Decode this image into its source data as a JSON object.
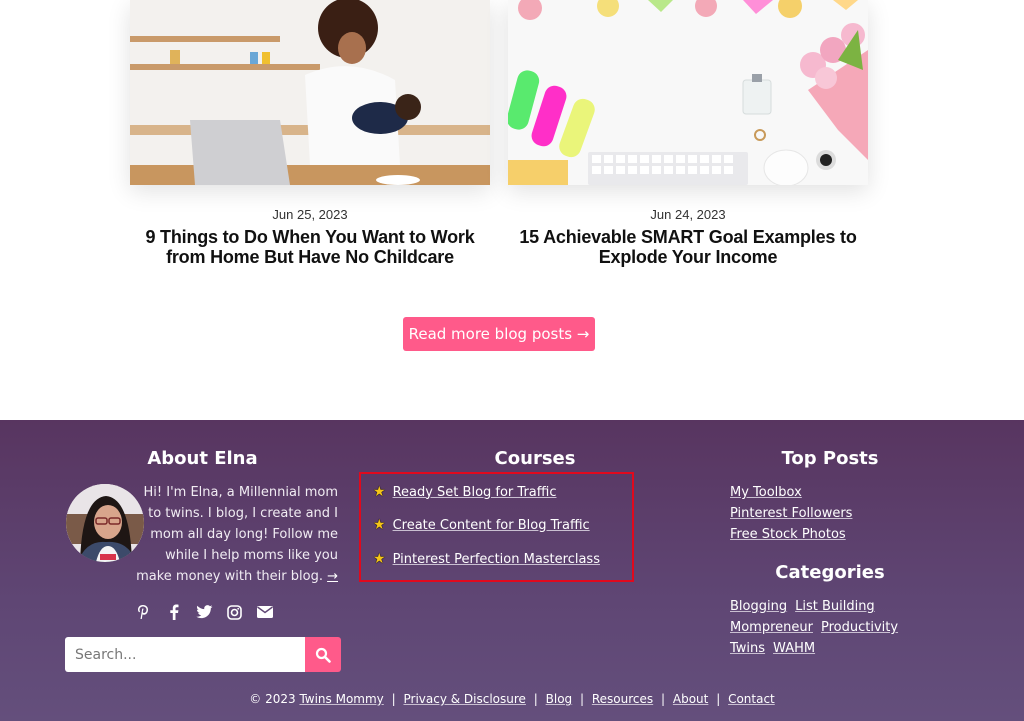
{
  "posts": [
    {
      "date": "Jun 25, 2023",
      "title": "9 Things to Do When You Want to Work from Home But Have No Childcare",
      "image": "mom-holding-baby-at-laptop"
    },
    {
      "date": "Jun 24, 2023",
      "title": "15 Achievable SMART Goal Examples to Explode Your Income",
      "image": "desk-flatlay-tulips-keyboard"
    }
  ],
  "read_more_label": "Read more blog posts →",
  "footer": {
    "about": {
      "title": "About Elna",
      "lines": [
        "Hi! I'm Elna, a Millennial mom",
        "to twins. I blog, I create and I",
        "mom all day long! Follow me",
        "while I help moms like you",
        "make money with their blog."
      ],
      "link_arrow": "→"
    },
    "social_icons": [
      "pinterest-icon",
      "facebook-icon",
      "twitter-icon",
      "instagram-icon",
      "email-icon"
    ],
    "search": {
      "placeholder": "Search...",
      "value": ""
    },
    "courses": {
      "title": "Courses",
      "items": [
        "Ready Set Blog for Traffic",
        "Create Content for Blog Traffic",
        "Pinterest Perfection Masterclass"
      ],
      "star": "★"
    },
    "top_posts": {
      "title": "Top Posts",
      "items": [
        "My Toolbox",
        "Pinterest Followers",
        "Free Stock Photos"
      ]
    },
    "categories": {
      "title": "Categories",
      "items": [
        "Blogging",
        "List Building",
        "Mompreneur",
        "Productivity",
        "Twins",
        "WAHM"
      ]
    },
    "copyright": {
      "prefix": "© 2023",
      "links": [
        "Twins Mommy",
        "Privacy & Disclosure",
        "Blog",
        "Resources",
        "About",
        "Contact"
      ],
      "separator": "|"
    }
  },
  "colors": {
    "accent": "#ff5a8a",
    "footer_bg": "#5c3d66",
    "highlight_border": "#e0091d",
    "star": "#f5c518"
  }
}
